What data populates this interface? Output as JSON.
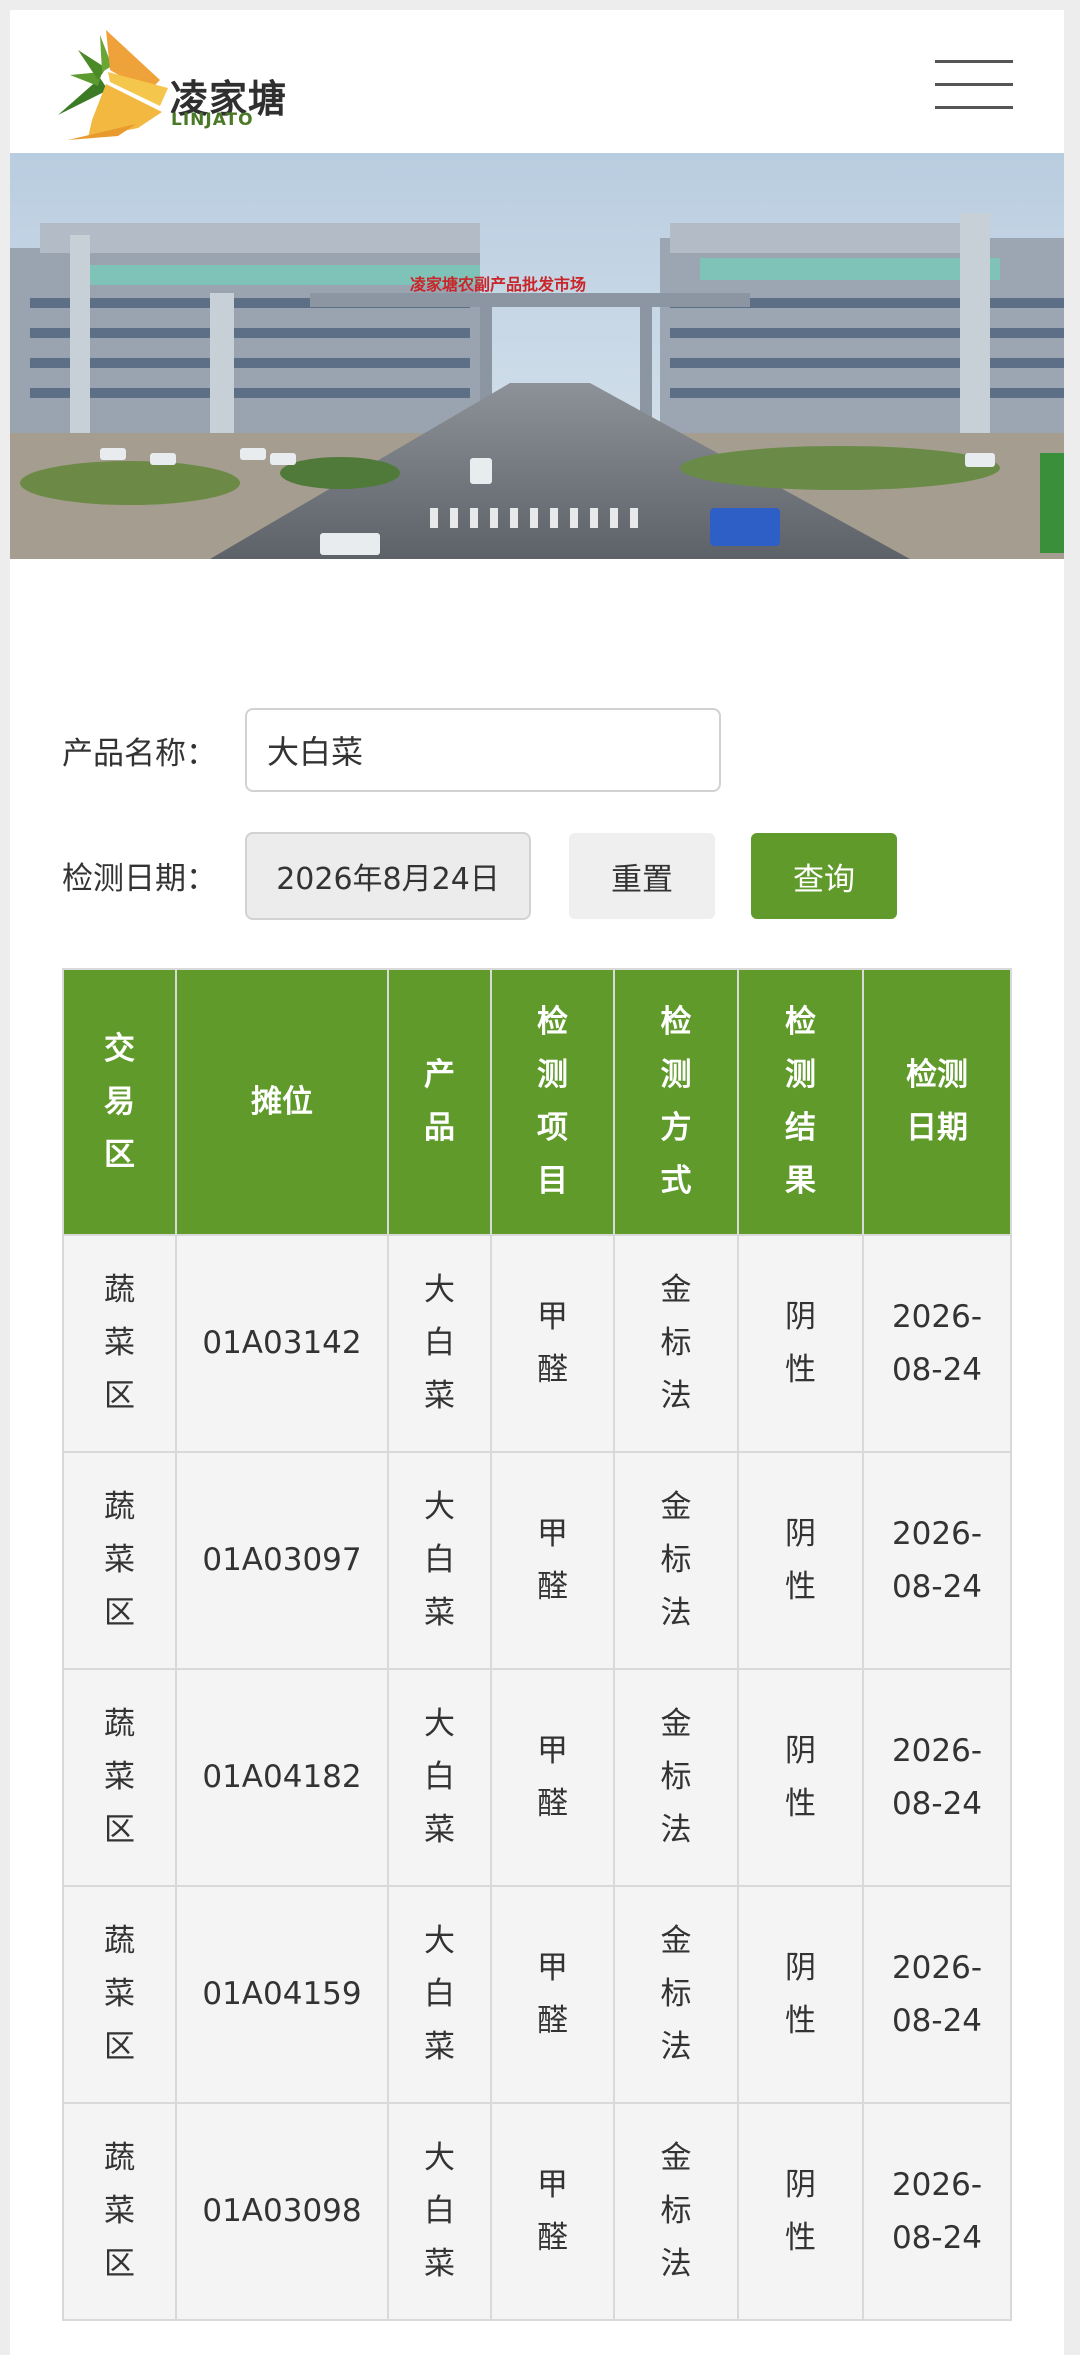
{
  "header": {
    "brand_cn": "凌家塘",
    "brand_en": "LINJATO"
  },
  "banner": {
    "sign_text": "凌家塘农副产品批发市场"
  },
  "form": {
    "product_label": "产品名称：",
    "product_value": "大白菜",
    "date_label": "检测日期：",
    "date_value": "2026年8月24日",
    "reset_label": "重置",
    "query_label": "查询"
  },
  "table": {
    "headers": [
      "交易区",
      "摊位",
      "产品",
      "检测项目",
      "检测方式",
      "检测结果",
      "检测日期"
    ],
    "rows": [
      [
        "蔬菜区",
        "01A03142",
        "大白菜",
        "甲醛",
        "金标法",
        "阴性",
        "2026-08-24"
      ],
      [
        "蔬菜区",
        "01A03097",
        "大白菜",
        "甲醛",
        "金标法",
        "阴性",
        "2026-08-24"
      ],
      [
        "蔬菜区",
        "01A04182",
        "大白菜",
        "甲醛",
        "金标法",
        "阴性",
        "2026-08-24"
      ],
      [
        "蔬菜区",
        "01A04159",
        "大白菜",
        "甲醛",
        "金标法",
        "阴性",
        "2026-08-24"
      ],
      [
        "蔬菜区",
        "01A03098",
        "大白菜",
        "甲醛",
        "金标法",
        "阴性",
        "2026-08-24"
      ]
    ]
  },
  "colors": {
    "brand_green": "#5f9a2b",
    "cell_bg": "#f4f4f4"
  }
}
